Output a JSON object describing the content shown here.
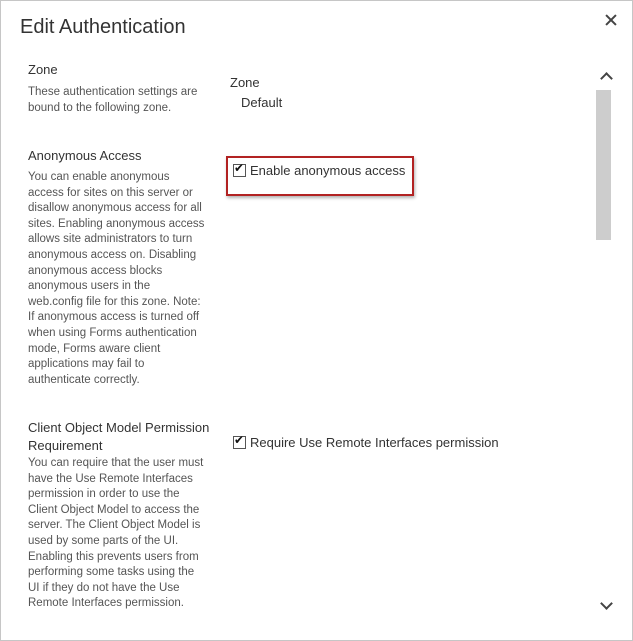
{
  "dialog": {
    "title": "Edit Authentication"
  },
  "zone": {
    "section_title": "Zone",
    "description": "These authentication settings are bound to the following zone.",
    "label": "Zone",
    "value": "Default"
  },
  "anonymous": {
    "section_title": "Anonymous Access",
    "description": "You can enable anonymous access for sites on this server or disallow anonymous access for all sites. Enabling anonymous access allows site administrators to turn anonymous access on. Disabling anonymous access blocks anonymous users in the web.config file for this zone. Note: If anonymous access is turned off when using Forms authentication mode, Forms aware client applications may fail to authenticate correctly.",
    "checkbox_label": "Enable anonymous access",
    "checked": true
  },
  "client_om": {
    "section_title": "Client Object Model Permission Requirement",
    "description": "You can require that the user must have the Use Remote Interfaces permission in order to use the Client Object Model to access the server. The Client Object Model is used by some parts of the UI. Enabling this prevents users from performing some tasks using the UI if they do not have the Use Remote Interfaces permission.",
    "checkbox_label": "Require Use Remote Interfaces permission",
    "checked": true
  },
  "colors": {
    "highlight_border": "#b22222",
    "scroll_thumb": "#cdcdcd"
  }
}
